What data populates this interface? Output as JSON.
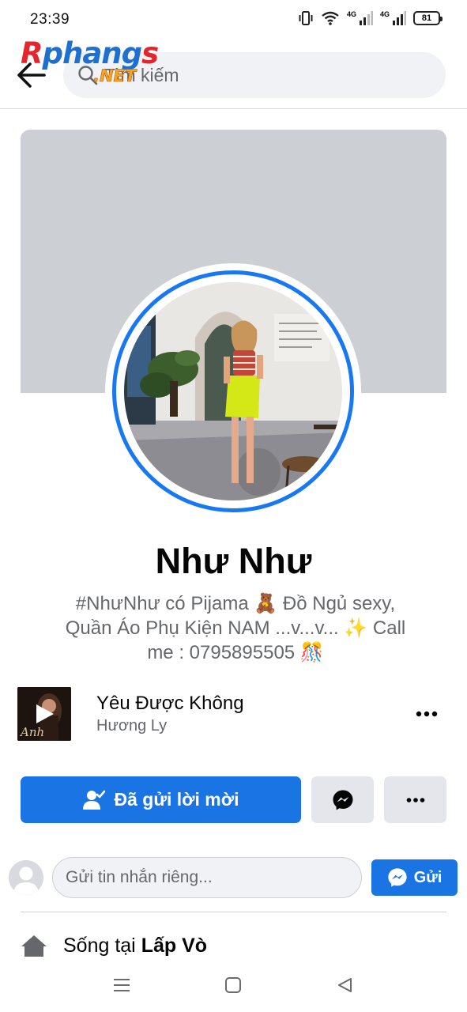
{
  "status_bar": {
    "time": "23:39",
    "network_1": "4G",
    "network_2": "4G",
    "battery": "81"
  },
  "watermark": {
    "brand": "Rphangs",
    "domain": ".NET"
  },
  "header": {
    "search_placeholder": "Tìm kiếm"
  },
  "profile": {
    "name": "Như Như",
    "bio_line_1": "#NhưNhư có Pijama 🧸 Đồ Ngủ sexy,",
    "bio_line_2": "Quần Áo Phụ Kiện NAM ...v...v... ✨ Call",
    "bio_line_3": "me : 0795895505 🎊"
  },
  "music": {
    "title": "Yêu Được Không",
    "artist": "Hương Ly",
    "thumb_text": "Anh"
  },
  "actions": {
    "friend_request_label": "Đã gửi lời mời"
  },
  "message": {
    "placeholder": "Gửi tin nhắn riêng...",
    "send_label": "Gửi"
  },
  "location": {
    "prefix": "Sống tại ",
    "place": "Lấp Vò"
  },
  "colors": {
    "accent": "#1b74e4",
    "ring": "#1877f2",
    "cover": "#ccd0d5",
    "secondary_button": "#e4e6eb"
  },
  "icons": {
    "back": "arrow-left-icon",
    "search": "search-icon",
    "add_friend": "person-check-icon",
    "messenger": "messenger-icon",
    "more": "more-dots-icon",
    "location": "home-icon"
  }
}
